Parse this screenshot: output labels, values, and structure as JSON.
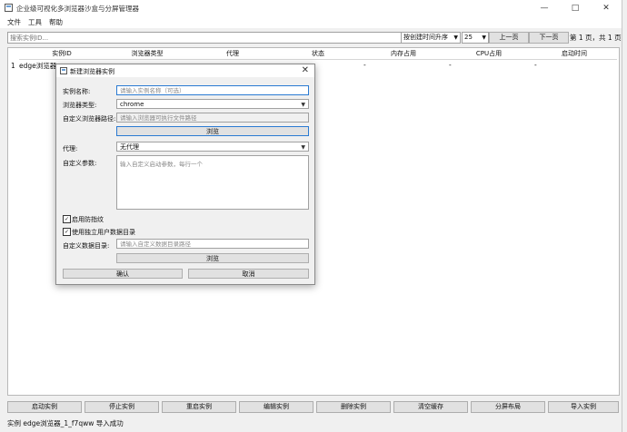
{
  "window": {
    "title": "企业级可视化多浏览器沙盒与分屏管理器",
    "menu": [
      "文件",
      "工具",
      "帮助"
    ]
  },
  "toolbar": {
    "search_placeholder": "搜索实例ID...",
    "sort_value": "按创建时间升序",
    "page_size": "25",
    "prev_label": "上一页",
    "next_label": "下一页",
    "page_info": "第 1 页，共 1 页"
  },
  "table": {
    "headers": [
      "实例ID",
      "浏览器类型",
      "代理",
      "状态",
      "内存占用",
      "CPU占用",
      "启动时间"
    ],
    "rows": [
      {
        "num": "1",
        "id": "edge浏览器_",
        "memory": "-",
        "cpu": "-",
        "start": "-",
        "status": "-"
      }
    ]
  },
  "bottom_buttons": [
    "启动实例",
    "停止实例",
    "重启实例",
    "编辑实例",
    "删除实例",
    "清空缓存",
    "分屏布局",
    "导入实例"
  ],
  "status_bar": "实例 edge浏览器_1_f7qww 导入成功",
  "dialog": {
    "title": "新建浏览器实例",
    "name_label": "实例名称:",
    "name_placeholder": "请输入实例名称（可选）",
    "type_label": "浏览器类型:",
    "type_value": "chrome",
    "path_label": "自定义浏览器路径:",
    "path_placeholder": "请输入浏览器可执行文件路径",
    "browse_label": "浏览",
    "proxy_label": "代理:",
    "proxy_value": "无代理",
    "args_label": "自定义参数:",
    "args_placeholder": "输入自定义启动参数，每行一个",
    "fingerprint_label": "启用防指纹",
    "userdata_label": "使用独立用户数据目录",
    "datadir_label": "自定义数据目录:",
    "datadir_placeholder": "请输入自定义数据目录路径",
    "browse2_label": "浏览",
    "confirm_label": "确认",
    "cancel_label": "取消"
  }
}
